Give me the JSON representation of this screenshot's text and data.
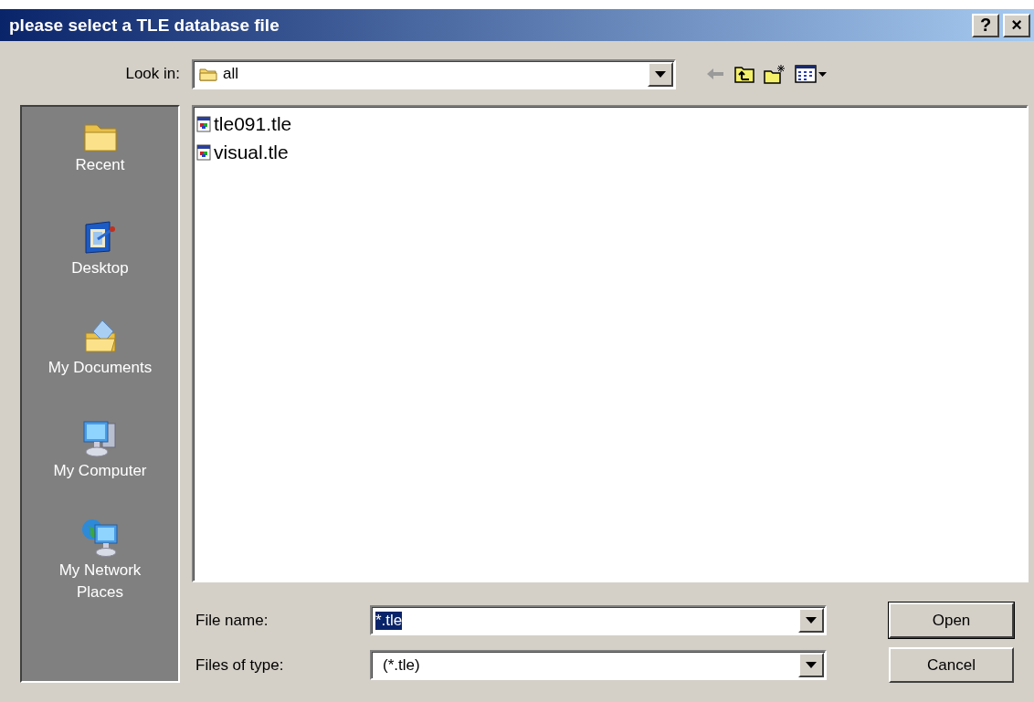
{
  "window": {
    "title": "please select a TLE database file",
    "title_buttons": [
      "?",
      "×"
    ]
  },
  "look_in": {
    "label": "Look in:",
    "value": "all"
  },
  "toolbar": [
    {
      "kind": "back",
      "disabled": true
    },
    {
      "kind": "up",
      "disabled": false
    },
    {
      "kind": "new-folder",
      "disabled": false
    },
    {
      "kind": "views",
      "disabled": false
    }
  ],
  "places": [
    {
      "label": "Recent"
    },
    {
      "label": "Desktop"
    },
    {
      "label": "My Documents"
    },
    {
      "label": "My Computer"
    },
    {
      "label": "My Network Places"
    }
  ],
  "files": [
    {
      "name": "tle091.tle"
    },
    {
      "name": "visual.tle"
    }
  ],
  "file_name": {
    "label": "File name:",
    "value": "*.tle",
    "text_selected": true
  },
  "file_type": {
    "label": "Files of type:",
    "value": "(*.tle)"
  },
  "buttons": [
    {
      "label": "Open",
      "default": true
    },
    {
      "label": "Cancel",
      "default": false
    }
  ]
}
